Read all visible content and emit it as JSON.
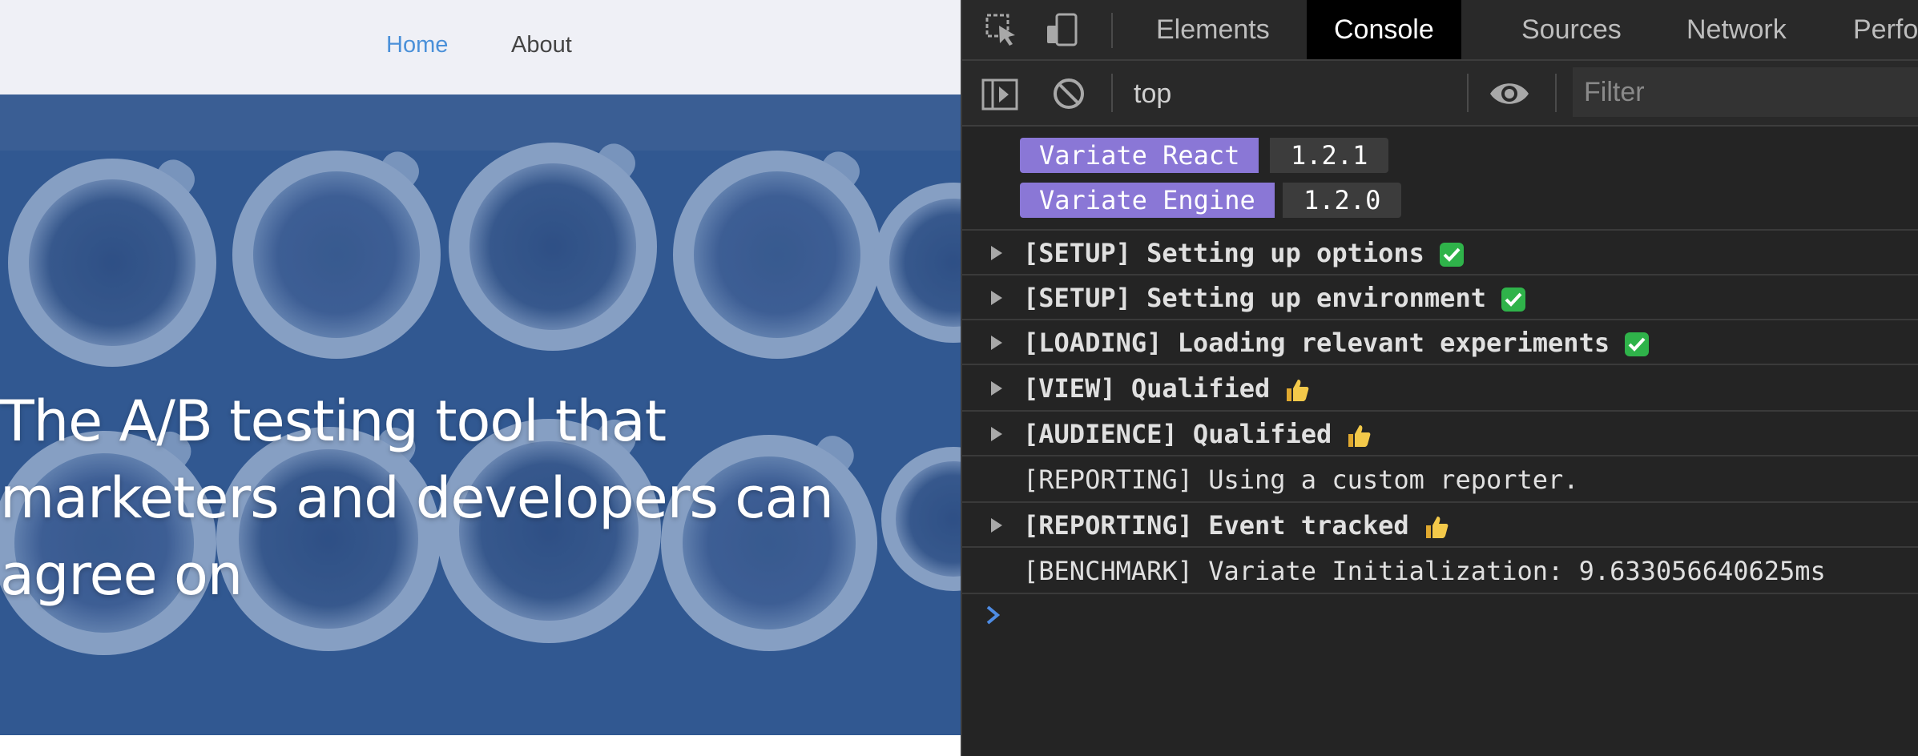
{
  "site": {
    "nav": {
      "home": "Home",
      "about": "About"
    },
    "hero_title_lines": [
      "The A/B testing tool that",
      "marketers and developers can",
      "agree on"
    ]
  },
  "devtools": {
    "tabs": [
      "Elements",
      "Console",
      "Sources",
      "Network",
      "Perform"
    ],
    "active_tab": "Console",
    "toolbar": {
      "context": "top",
      "filter_placeholder": "Filter"
    },
    "badges": [
      {
        "name": "Variate React",
        "version": "1.2.1"
      },
      {
        "name": "Variate Engine",
        "version": "1.2.0"
      }
    ],
    "logs": [
      {
        "text": "[SETUP] Setting up options",
        "icon": "check-mark-icon"
      },
      {
        "text": "[SETUP] Setting up environment",
        "icon": "check-mark-icon"
      },
      {
        "text": "[LOADING] Loading relevant experiments",
        "icon": "check-mark-icon"
      },
      {
        "text": "[VIEW] Qualified",
        "icon": "thumbs-up-icon"
      },
      {
        "text": "[AUDIENCE] Qualified",
        "icon": "thumbs-up-icon"
      },
      {
        "text": "[REPORTING] Using a custom reporter."
      },
      {
        "text": "[REPORTING] Event tracked",
        "icon": "thumbs-up-icon"
      },
      {
        "text": "[BENCHMARK] Variate Initialization: 9.633056640625ms"
      }
    ]
  },
  "colors": {
    "badge_accent": "#8a77d6",
    "link_active": "#4a90d9",
    "hero_overlay": "#32578e",
    "devtools_bg": "#242424",
    "check_green": "#2fb34a",
    "thumbs_yellow": "#f3c94a"
  }
}
